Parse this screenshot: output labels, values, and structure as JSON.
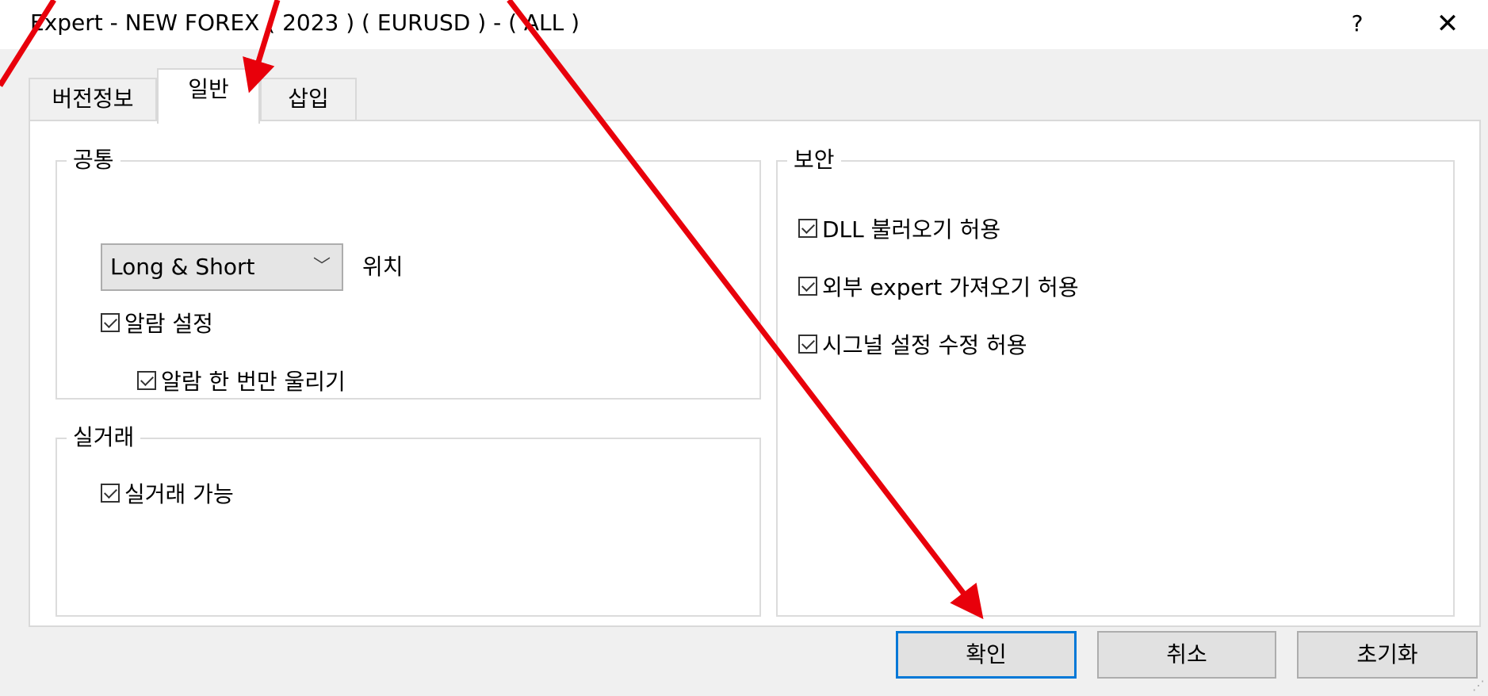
{
  "window": {
    "title": "Expert - NEW FOREX ( 2023 ) ( EURUSD ) - ( ALL )",
    "help_label": "?",
    "close_label": "✕"
  },
  "tabs": [
    {
      "label": "버전정보",
      "active": false
    },
    {
      "label": "일반",
      "active": true
    },
    {
      "label": "삽입",
      "active": false
    }
  ],
  "common": {
    "group_label": "공통",
    "position_select": {
      "value": "Long & Short"
    },
    "position_label": "위치",
    "alarm_setting": {
      "label": "알람 설정",
      "checked": true
    },
    "alarm_once": {
      "label": "알람 한 번만 울리기",
      "checked": true
    }
  },
  "live_trading": {
    "group_label": "실거래",
    "enable": {
      "label": "실거래 가능",
      "checked": true
    }
  },
  "security": {
    "group_label": "보안",
    "allow_dll": {
      "label": "DLL 불러오기 허용",
      "checked": true
    },
    "allow_external_expert": {
      "label": "외부 expert 가져오기 허용",
      "checked": true
    },
    "allow_signal_edit": {
      "label": "시그널 설정 수정 허용",
      "checked": true
    }
  },
  "buttons": {
    "ok": "확인",
    "cancel": "취소",
    "reset": "초기화"
  },
  "annotation_color": "#e8000b"
}
